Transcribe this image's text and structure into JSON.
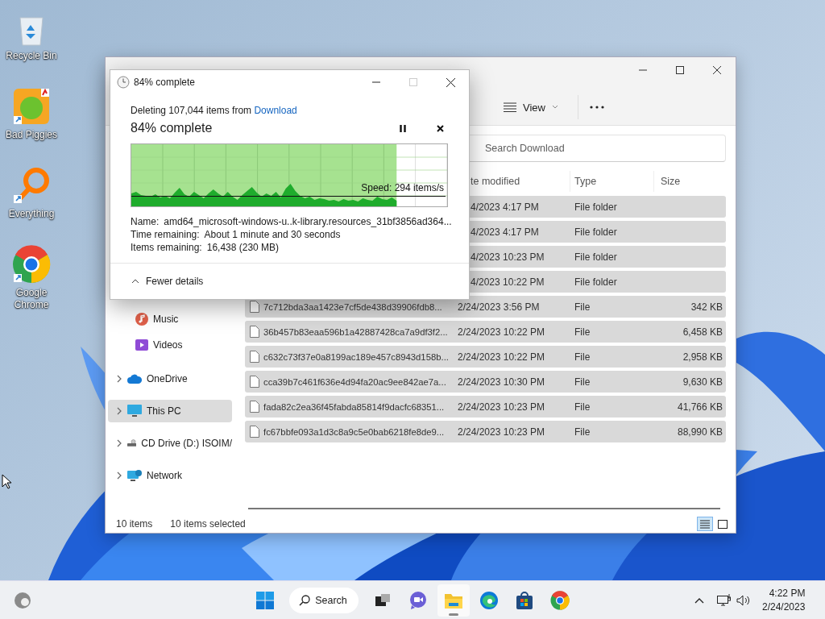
{
  "desktop_icons": [
    {
      "label": "Recycle Bin"
    },
    {
      "label": "Bad Piggies"
    },
    {
      "label": "Everything"
    },
    {
      "label": "Google Chrome"
    }
  ],
  "explorer": {
    "toolbar": {
      "view_label": "View"
    },
    "search": {
      "placeholder": "Search Download"
    },
    "columns": [
      "te modified",
      "Type",
      "Size"
    ],
    "rows": [
      {
        "date": "4/2023 4:17 PM",
        "type": "File folder",
        "selected": true
      },
      {
        "date": "4/2023 4:17 PM",
        "type": "File folder",
        "selected": true
      },
      {
        "date": "4/2023 10:23 PM",
        "type": "File folder",
        "selected": true
      },
      {
        "date": "4/2023 10:22 PM",
        "type": "File folder",
        "selected": true
      },
      {
        "name": "7c712bda3aa1423e7cf5de438d39906fdb8...",
        "date": "2/24/2023 3:56 PM",
        "type": "File",
        "size": "342 KB",
        "selected": true
      },
      {
        "name": "36b457b83eaa596b1a42887428ca7a9df3f2...",
        "date": "2/24/2023 10:22 PM",
        "type": "File",
        "size": "6,458 KB",
        "selected": true
      },
      {
        "name": "c632c73f37e0a8199ac189e457c8943d158b...",
        "date": "2/24/2023 10:22 PM",
        "type": "File",
        "size": "2,958 KB",
        "selected": true
      },
      {
        "name": "cca39b7c461f636e4d94fa20ac9ee842ae7a...",
        "date": "2/24/2023 10:30 PM",
        "type": "File",
        "size": "9,630 KB",
        "selected": true
      },
      {
        "name": "fada82c2ea36f45fabda85814f9dacfc68351...",
        "date": "2/24/2023 10:23 PM",
        "type": "File",
        "size": "41,766 KB",
        "selected": true
      },
      {
        "name": "fc67bbfe093a1d3c8a9c5e0bab6218fe8de9...",
        "date": "2/24/2023 10:23 PM",
        "type": "File",
        "size": "88,990 KB",
        "selected": true
      }
    ],
    "sidebar": {
      "items": [
        {
          "label": "Music",
          "kind": "pinned",
          "selected": false
        },
        {
          "label": "Videos",
          "kind": "pinned",
          "selected": false
        },
        {
          "label": "OneDrive",
          "kind": "location",
          "selected": false
        },
        {
          "label": "This PC",
          "kind": "location",
          "selected": true
        },
        {
          "label": "CD Drive (D:) ISOIM/",
          "kind": "location",
          "selected": false
        },
        {
          "label": "Network",
          "kind": "location",
          "selected": false
        }
      ]
    },
    "status_bar": {
      "count": "10 items",
      "selection": "10 items selected",
      "views": [
        {
          "selected": true
        },
        {
          "selected": false
        }
      ]
    }
  },
  "dialog": {
    "title": "84% complete",
    "message": "Deleting 107,044 items from",
    "source_link": "Download",
    "heading": "84% complete",
    "progress": {
      "level": 0.84
    },
    "speed": "Speed: 294 items/s",
    "details": [
      {
        "label": "Name:",
        "value": "amd64_microsoft-windows-u..k-library.resources_31bf3856ad364..."
      },
      {
        "label": "Time remaining:",
        "value": "About 1 minute and 30 seconds"
      },
      {
        "label": "Items remaining:",
        "value": "16,438 (230 MB)"
      }
    ],
    "toggle_label": "Fewer details"
  },
  "taskbar": {
    "search_label": "Search",
    "apps": [
      {
        "active": false
      },
      {
        "active": false
      },
      {
        "active": true
      },
      {
        "active": false
      },
      {
        "active": false
      },
      {
        "active": false
      }
    ],
    "time": "4:22 PM",
    "date": "2/24/2023"
  }
}
